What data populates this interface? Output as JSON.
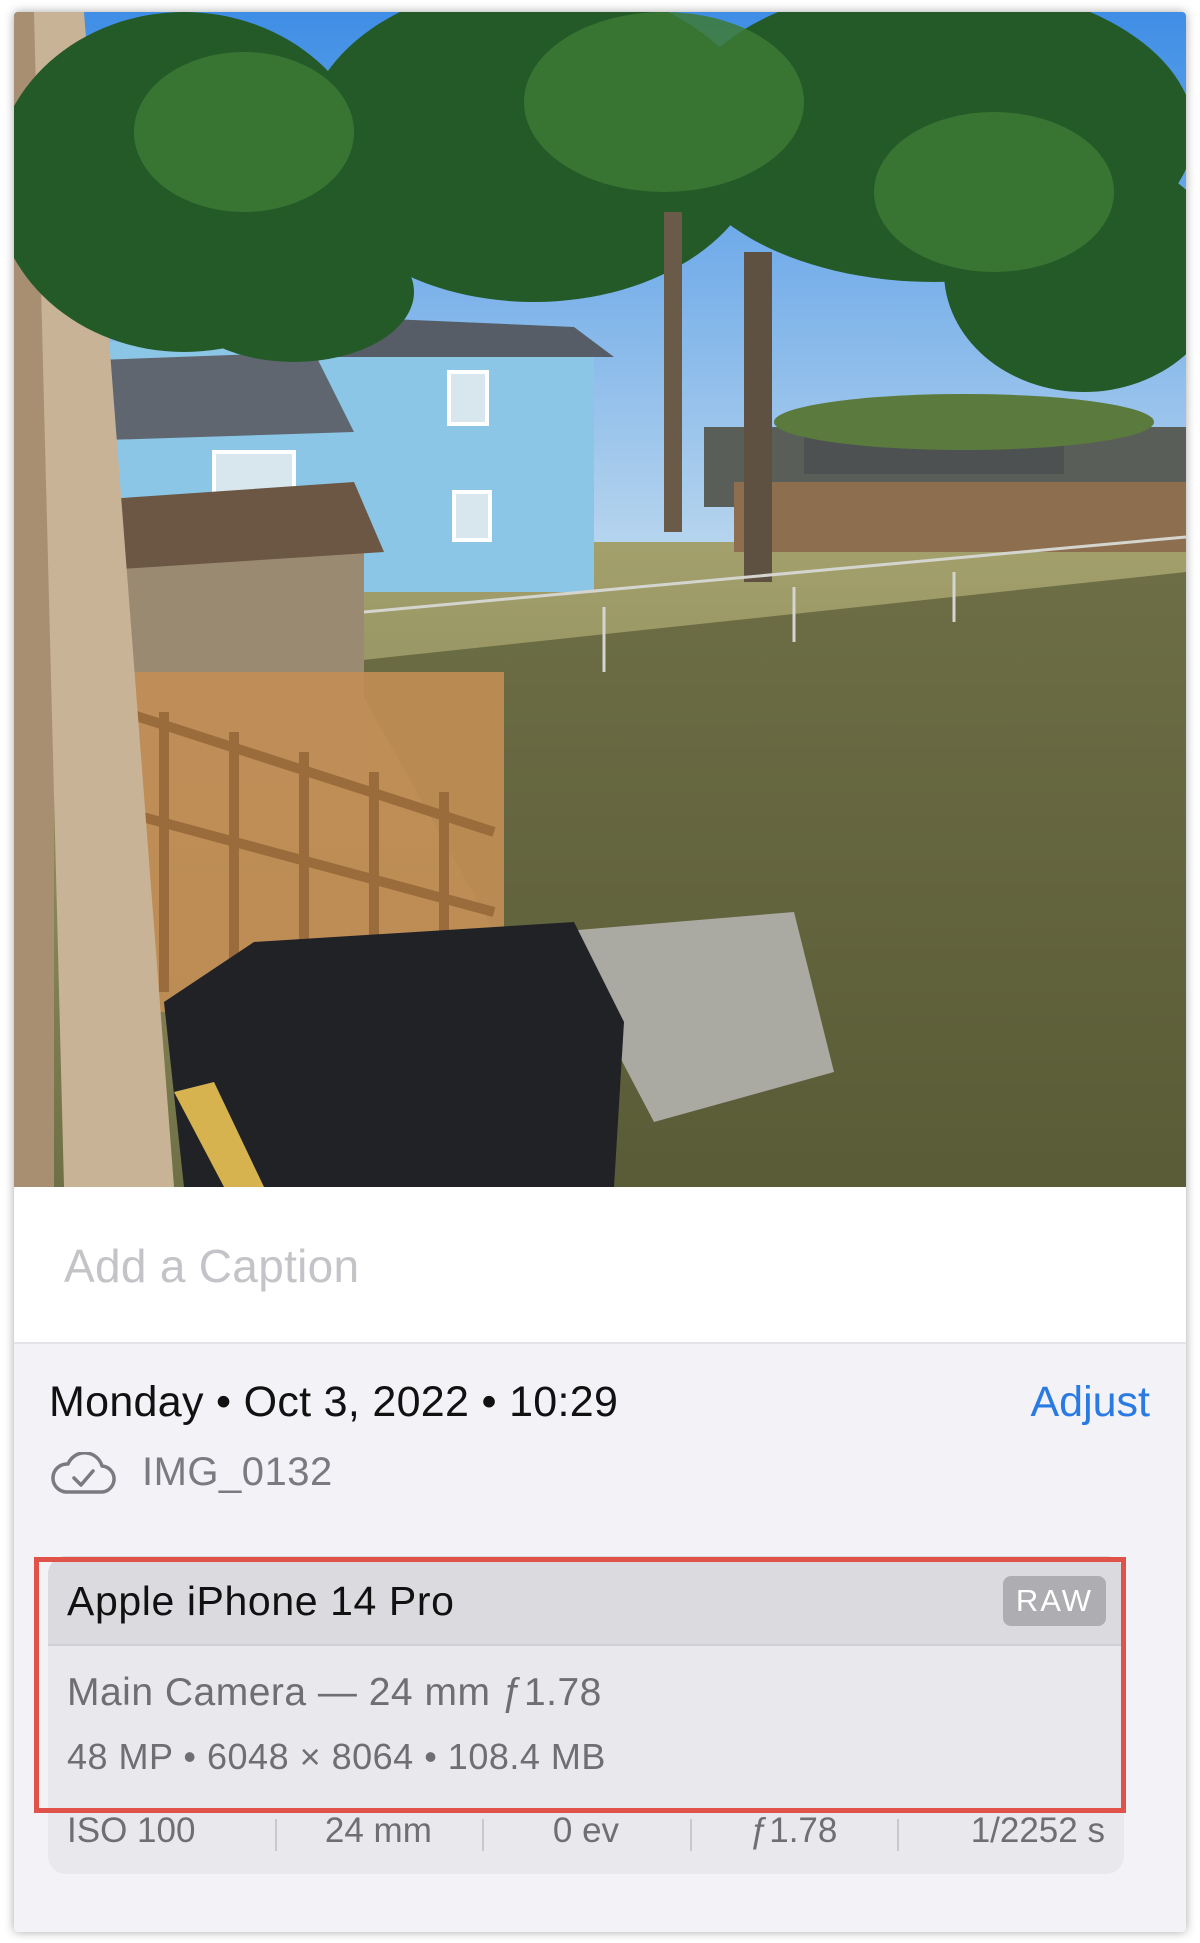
{
  "caption": {
    "placeholder": "Add a Caption"
  },
  "info": {
    "date_line": "Monday • Oct 3, 2022 • 10:29",
    "adjust_label": "Adjust",
    "filename": "IMG_0132",
    "cloud_icon": "icloud-check-icon"
  },
  "device": {
    "name": "Apple iPhone 14 Pro",
    "raw_badge": "RAW",
    "lens": "Main Camera — 24 mm ƒ1.78",
    "specs": "48 MP  •  6048 × 8064  •  108.4 MB",
    "exif": [
      "ISO 100",
      "24 mm",
      "0 ev",
      "ƒ1.78",
      "1/2252 s"
    ]
  },
  "colors": {
    "accent": "#2a7ae4",
    "highlight_border": "#e0534a",
    "badge_bg": "#aeaeb2"
  }
}
